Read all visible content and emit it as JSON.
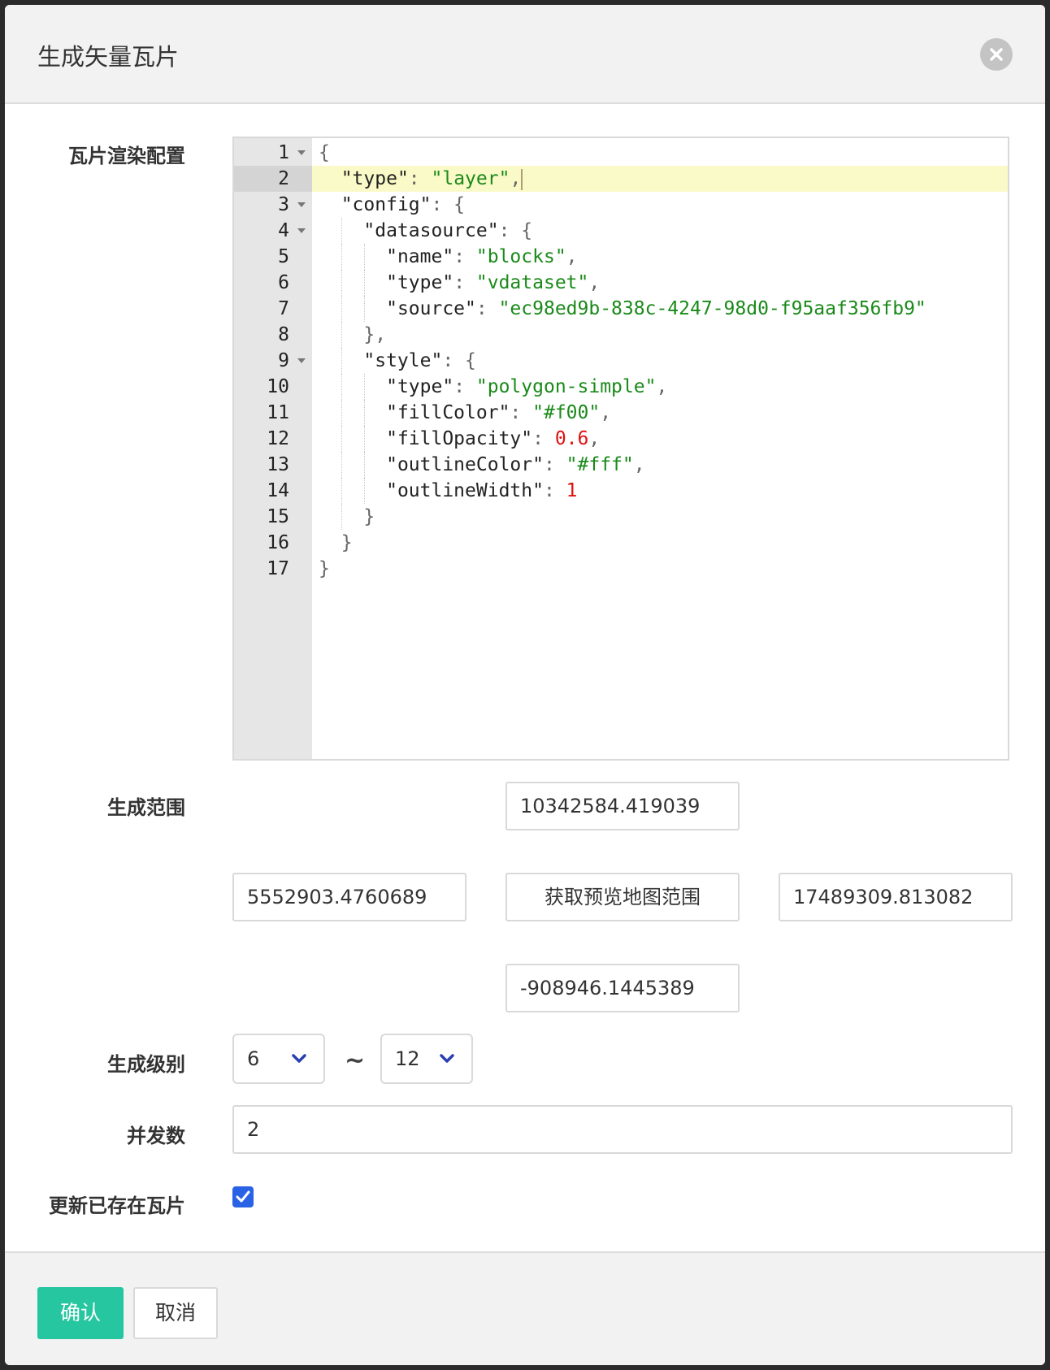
{
  "dialog": {
    "title": "生成矢量瓦片",
    "close_icon": "close-icon"
  },
  "form": {
    "render_config_label": "瓦片渲染配置",
    "extent_label": "生成范围",
    "level_label": "生成级别",
    "concurrency_label": "并发数",
    "update_label": "更新已存在瓦片"
  },
  "editor": {
    "lines": [
      {
        "n": "1",
        "fold": true,
        "indent": 0,
        "tokens": [
          [
            "p",
            "{"
          ]
        ]
      },
      {
        "n": "2",
        "fold": false,
        "indent": 1,
        "active": true,
        "tokens": [
          [
            "k",
            "\"type\""
          ],
          [
            "p",
            ": "
          ],
          [
            "s",
            "\"layer\""
          ],
          [
            "p",
            ","
          ]
        ]
      },
      {
        "n": "3",
        "fold": true,
        "indent": 1,
        "tokens": [
          [
            "k",
            "\"config\""
          ],
          [
            "p",
            ": {"
          ]
        ]
      },
      {
        "n": "4",
        "fold": true,
        "indent": 2,
        "tokens": [
          [
            "k",
            "\"datasource\""
          ],
          [
            "p",
            ": {"
          ]
        ]
      },
      {
        "n": "5",
        "fold": false,
        "indent": 3,
        "tokens": [
          [
            "k",
            "\"name\""
          ],
          [
            "p",
            ": "
          ],
          [
            "s",
            "\"blocks\""
          ],
          [
            "p",
            ","
          ]
        ]
      },
      {
        "n": "6",
        "fold": false,
        "indent": 3,
        "tokens": [
          [
            "k",
            "\"type\""
          ],
          [
            "p",
            ": "
          ],
          [
            "s",
            "\"vdataset\""
          ],
          [
            "p",
            ","
          ]
        ]
      },
      {
        "n": "7",
        "fold": false,
        "indent": 3,
        "tokens": [
          [
            "k",
            "\"source\""
          ],
          [
            "p",
            ": "
          ],
          [
            "s",
            "\"ec98ed9b-838c-4247-98d0-f95aaf356fb9\""
          ]
        ]
      },
      {
        "n": "8",
        "fold": false,
        "indent": 2,
        "tokens": [
          [
            "p",
            "},"
          ]
        ]
      },
      {
        "n": "9",
        "fold": true,
        "indent": 2,
        "tokens": [
          [
            "k",
            "\"style\""
          ],
          [
            "p",
            ": {"
          ]
        ]
      },
      {
        "n": "10",
        "fold": false,
        "indent": 3,
        "tokens": [
          [
            "k",
            "\"type\""
          ],
          [
            "p",
            ": "
          ],
          [
            "s",
            "\"polygon-simple\""
          ],
          [
            "p",
            ","
          ]
        ]
      },
      {
        "n": "11",
        "fold": false,
        "indent": 3,
        "tokens": [
          [
            "k",
            "\"fillColor\""
          ],
          [
            "p",
            ": "
          ],
          [
            "s",
            "\"#f00\""
          ],
          [
            "p",
            ","
          ]
        ]
      },
      {
        "n": "12",
        "fold": false,
        "indent": 3,
        "tokens": [
          [
            "k",
            "\"fillOpacity\""
          ],
          [
            "p",
            ": "
          ],
          [
            "n",
            "0.6"
          ],
          [
            "p",
            ","
          ]
        ]
      },
      {
        "n": "13",
        "fold": false,
        "indent": 3,
        "tokens": [
          [
            "k",
            "\"outlineColor\""
          ],
          [
            "p",
            ": "
          ],
          [
            "s",
            "\"#fff\""
          ],
          [
            "p",
            ","
          ]
        ]
      },
      {
        "n": "14",
        "fold": false,
        "indent": 3,
        "tokens": [
          [
            "k",
            "\"outlineWidth\""
          ],
          [
            "p",
            ": "
          ],
          [
            "n",
            "1"
          ]
        ]
      },
      {
        "n": "15",
        "fold": false,
        "indent": 2,
        "tokens": [
          [
            "p",
            "}"
          ]
        ]
      },
      {
        "n": "16",
        "fold": false,
        "indent": 1,
        "tokens": [
          [
            "p",
            "}"
          ]
        ]
      },
      {
        "n": "17",
        "fold": false,
        "indent": 0,
        "tokens": [
          [
            "p",
            "}"
          ]
        ]
      }
    ]
  },
  "extent": {
    "top": "10342584.419039",
    "left": "5552903.4760689",
    "button": "获取预览地图范围",
    "right": "17489309.813082",
    "bottom": "-908946.1445389"
  },
  "levels": {
    "min": "6",
    "separator": "~",
    "max": "12"
  },
  "concurrency": "2",
  "update_existing": true,
  "footer": {
    "ok": "确认",
    "cancel": "取消"
  },
  "colors": {
    "primary": "#26c6a0",
    "checkbox": "#2a62e6",
    "string": "#1a8a1a",
    "number": "#e01010",
    "active_line": "#fafac8"
  }
}
